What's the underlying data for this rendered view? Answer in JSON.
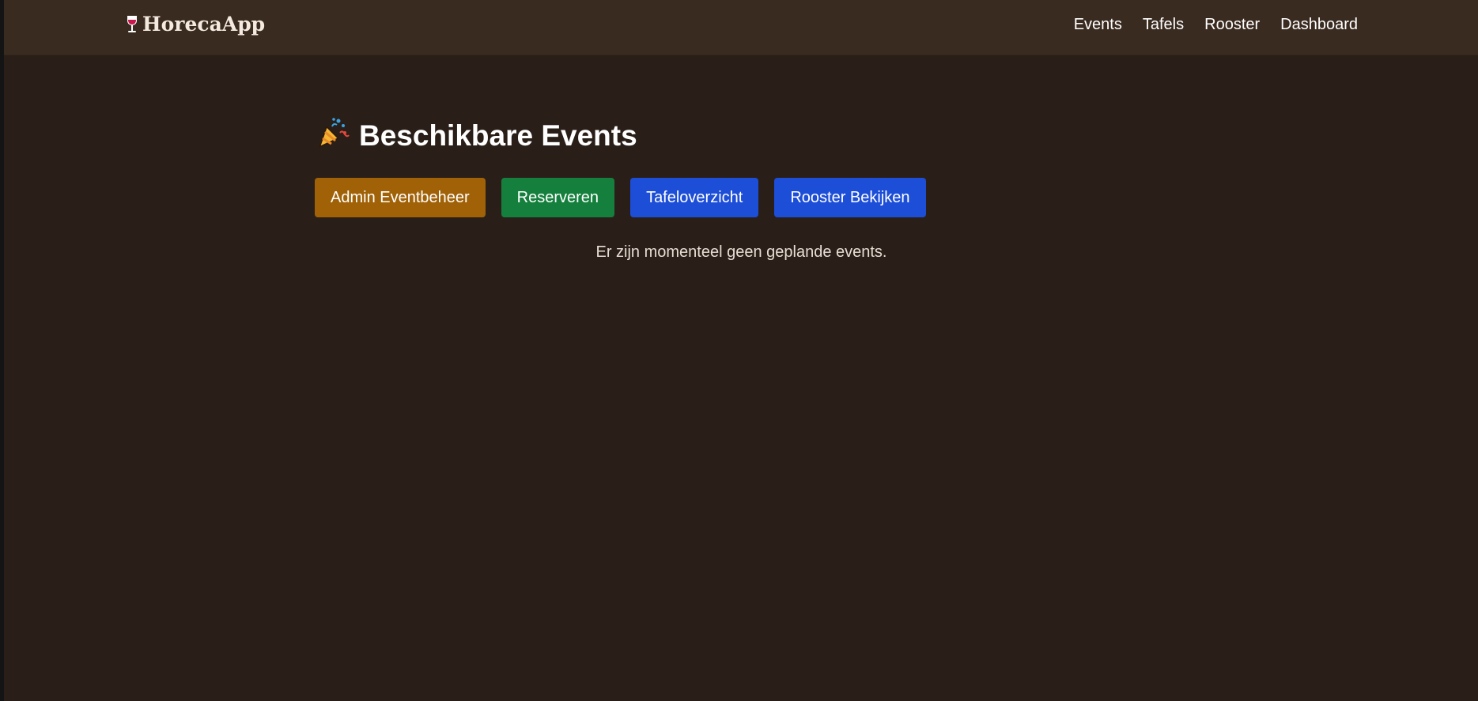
{
  "app": {
    "brand_name": "HorecaApp",
    "brand_icon": "wine-glass-icon"
  },
  "nav": {
    "items": [
      {
        "label": "Events"
      },
      {
        "label": "Tafels"
      },
      {
        "label": "Rooster"
      },
      {
        "label": "Dashboard"
      }
    ]
  },
  "main": {
    "title": "Beschikbare Events",
    "title_icon": "party-popper-icon",
    "buttons": [
      {
        "label": "Admin Eventbeheer",
        "color": "#a16207"
      },
      {
        "label": "Reserveren",
        "color": "#15803d"
      },
      {
        "label": "Tafeloverzicht",
        "color": "#1d4ed8"
      },
      {
        "label": "Rooster Bekijken",
        "color": "#1d4ed8"
      }
    ],
    "empty_message": "Er zijn momenteel geen geplande events."
  },
  "colors": {
    "background": "#2a1f18",
    "navbar": "#3a2b20"
  }
}
